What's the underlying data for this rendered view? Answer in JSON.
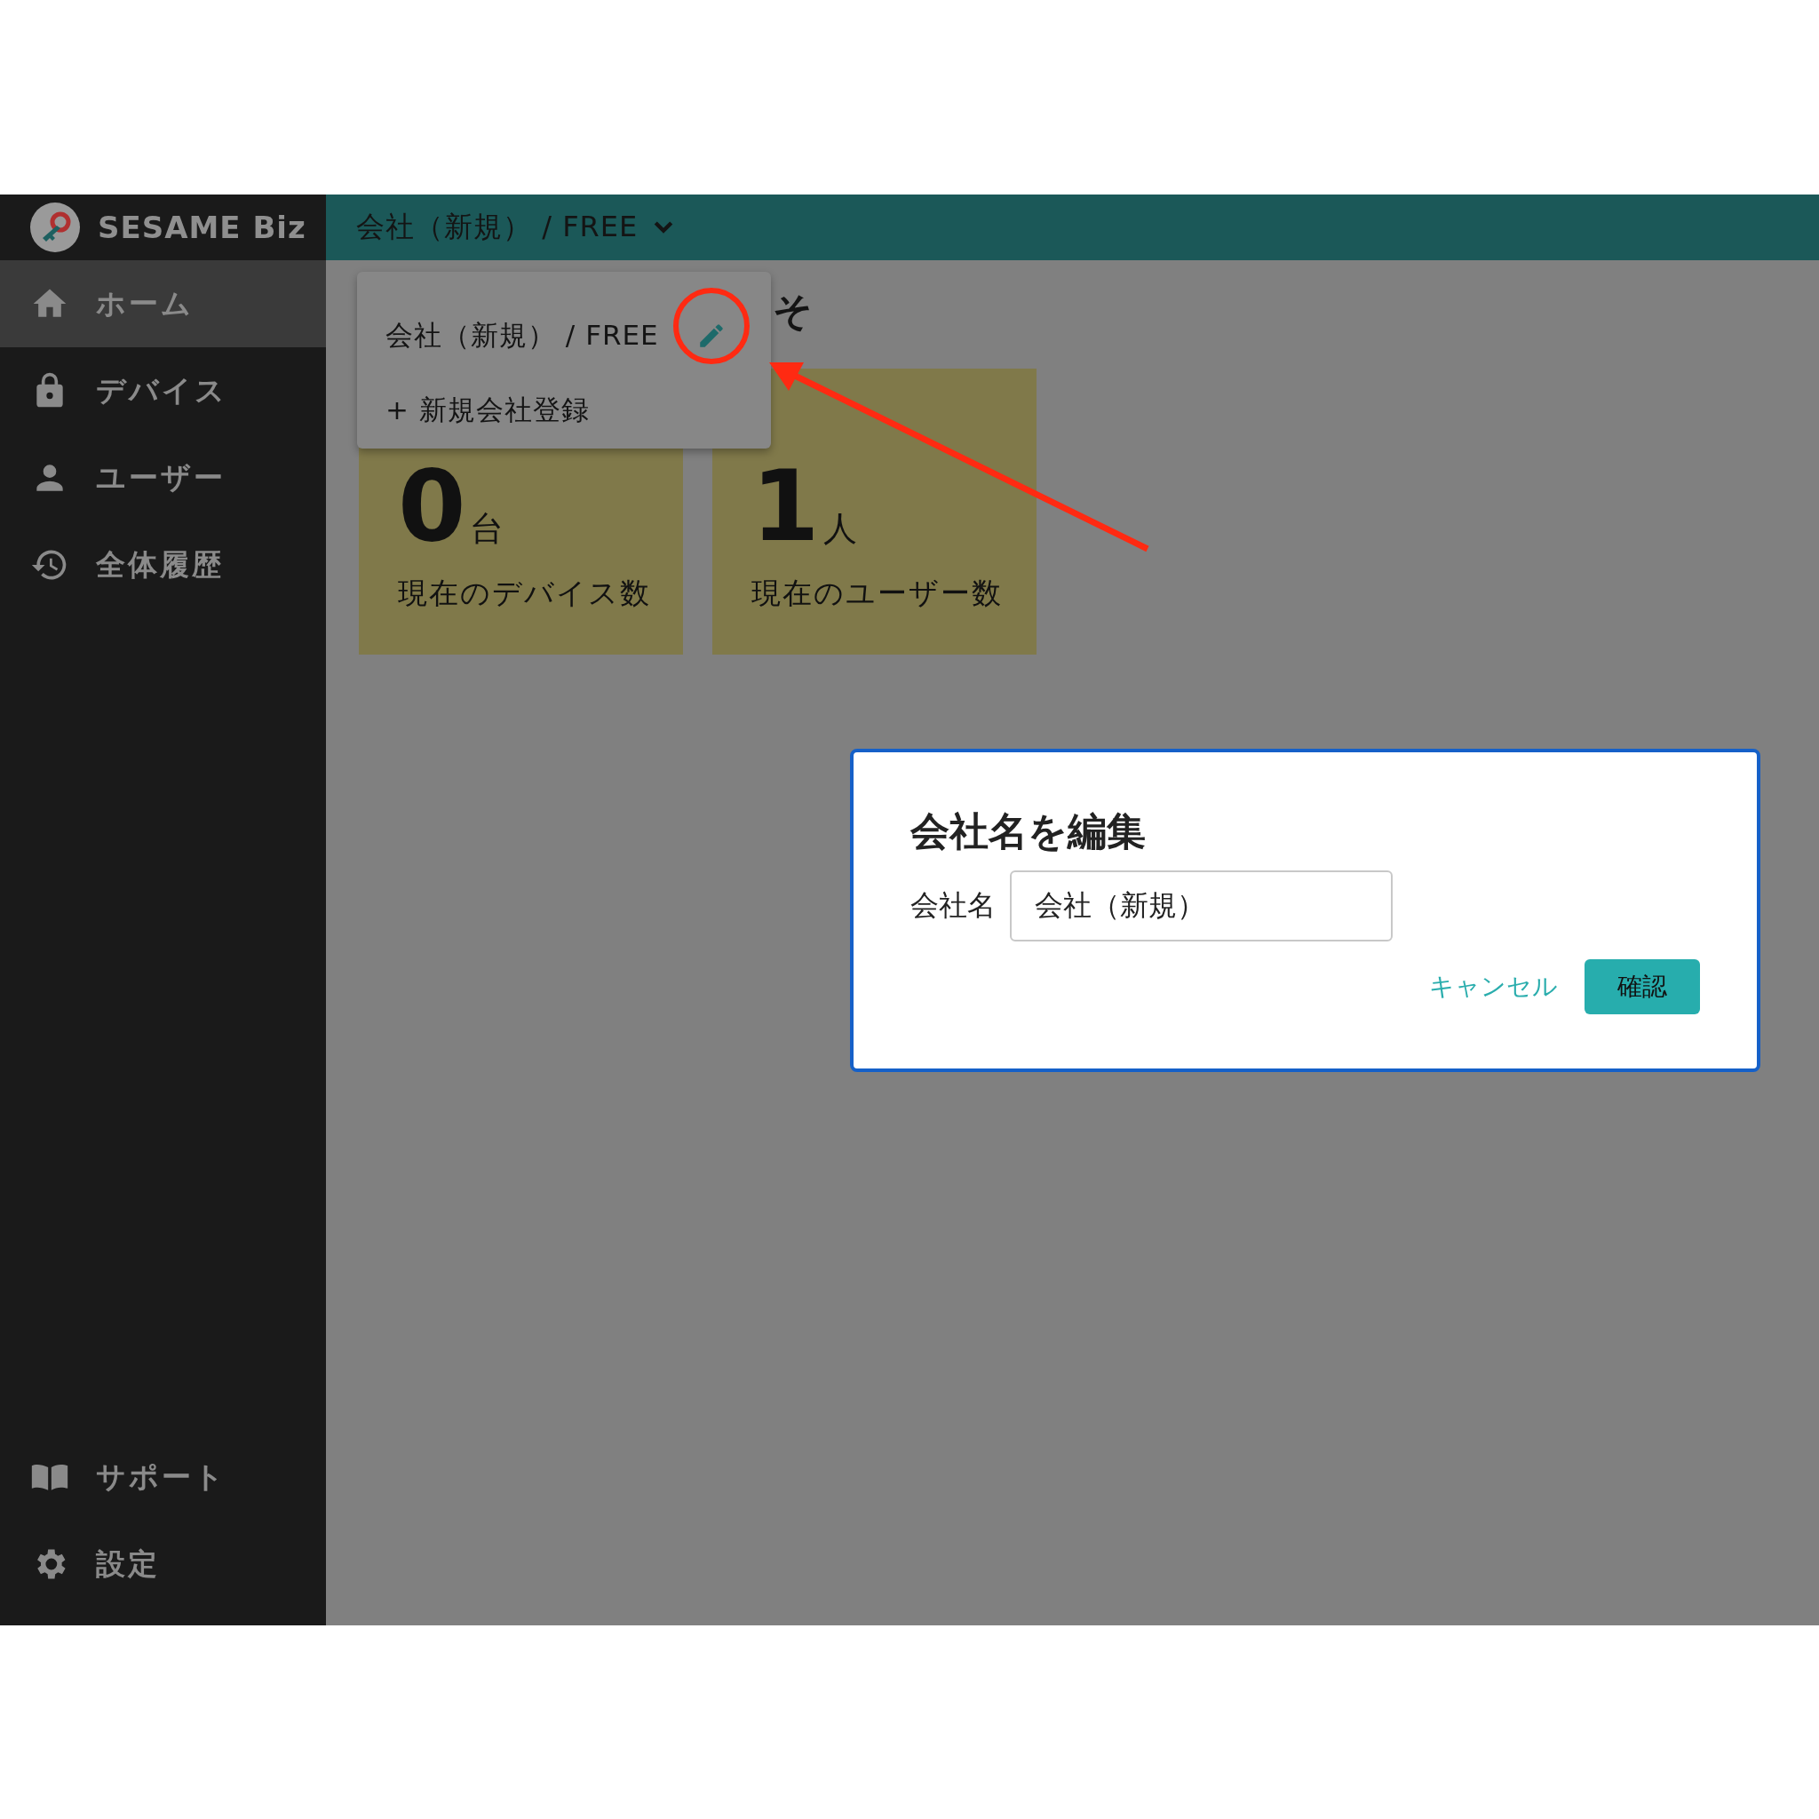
{
  "app": {
    "name": "SESAME Biz"
  },
  "sidebar": {
    "items": [
      {
        "label": "ホーム",
        "selected": true
      },
      {
        "label": "デバイス",
        "selected": false
      },
      {
        "label": "ユーザー",
        "selected": false
      },
      {
        "label": "全体履歴",
        "selected": false
      }
    ],
    "bottom_items": [
      {
        "label": "サポート"
      },
      {
        "label": "設定"
      }
    ]
  },
  "header": {
    "company": "会社（新規） / FREE"
  },
  "dropdown": {
    "items": [
      {
        "kind": "company",
        "label": "会社（新規） / FREE"
      },
      {
        "kind": "add",
        "label": "+ 新規会社登録"
      }
    ]
  },
  "heading": "そ",
  "cards": [
    {
      "value": "0",
      "unit": "台",
      "label": "現在のデバイス数"
    },
    {
      "value": "1",
      "unit": "人",
      "label": "現在のユーザー数"
    }
  ],
  "dialog": {
    "title": "会社名を編集",
    "field_label": "会社名",
    "field_value": "会社（新規）",
    "cancel": "キャンセル",
    "confirm": "確認"
  }
}
